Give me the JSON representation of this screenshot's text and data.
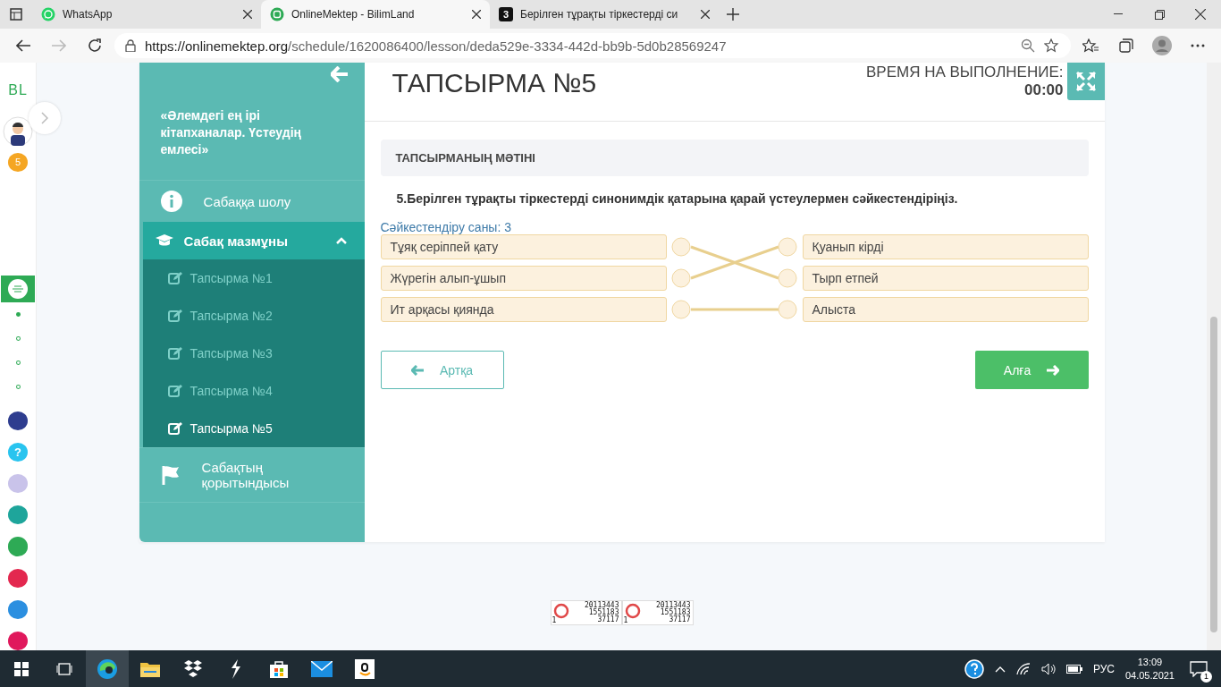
{
  "browser": {
    "tabs": [
      {
        "title": "WhatsApp",
        "selected": false
      },
      {
        "title": "OnlineMektep - BilimLand",
        "selected": true
      },
      {
        "title": "Берілген тұрақты тіркестерді си",
        "badge": "3",
        "selected": false
      }
    ],
    "url_host": "https://onlinemektep.org",
    "url_path": "/schedule/1620086400/lesson/deda529e-3334-442d-bb9b-5d0b28569247"
  },
  "rail": {
    "logo": "BL",
    "badge": "5",
    "steps": [
      {
        "selected": true
      },
      {
        "selected": false
      },
      {
        "selected": false
      },
      {
        "selected": false
      }
    ],
    "apps": [
      {
        "color": "#2e3d8f"
      },
      {
        "color": "#29c4ef",
        "label": "?"
      },
      {
        "color": "#c9c3ea"
      },
      {
        "color": "#1ea59b"
      },
      {
        "color": "#2eaa55"
      },
      {
        "color": "#e3284f"
      },
      {
        "color": "#2b8fe0"
      },
      {
        "color": "#e0185c"
      }
    ]
  },
  "sidebar": {
    "lesson_title": "«Әлемдегі ең ірі кітапханалар. Үстеудің емлесі»",
    "items": [
      {
        "kind": "info",
        "label": "Сабаққа шолу"
      },
      {
        "kind": "section",
        "label": "Сабақ мазмұны",
        "expanded": true,
        "children": [
          {
            "label": "Тапсырма №1",
            "selected": false
          },
          {
            "label": "Тапсырма №2",
            "selected": false
          },
          {
            "label": "Тапсырма №3",
            "selected": false
          },
          {
            "label": "Тапсырма №4",
            "selected": false
          },
          {
            "label": "Тапсырма №5",
            "selected": true
          }
        ]
      },
      {
        "kind": "flag",
        "label": "Сабақтың қорытындысы"
      }
    ]
  },
  "task": {
    "title": "ТАПСЫРМА №5",
    "timer_label": "ВРЕМЯ НА ВЫПОЛНЕНИЕ:",
    "timer": "00:00",
    "panel_heading": "ТАПСЫРМАНЫҢ МӘТІНІ",
    "question": "5.Берілген тұрақты тіркестерді синонимдік қатарына қарай үстеулермен сәйкестендіріңіз.",
    "match_count": "Сәйкестендіру саны: 3",
    "left": [
      "Тұяқ серіппей қату",
      "Жүрегін алып-ұшып",
      "Ит арқасы қиянда"
    ],
    "right": [
      "Қуанып кірді",
      "Тырп етпей",
      "Алыста"
    ],
    "links": [
      {
        "kind": "down"
      },
      {
        "kind": "up"
      },
      {
        "kind": "straight"
      }
    ],
    "back_button": "Артқа",
    "next_button": "Алға"
  },
  "counters": [
    {
      "lines": [
        "20113443",
        "1551183",
        "37117"
      ],
      "corner": "1"
    },
    {
      "lines": [
        "20113443",
        "1551183",
        "37117"
      ],
      "corner": "1"
    }
  ],
  "taskbar": {
    "language": "РУС",
    "time": "13:09",
    "date": "04.05.2021",
    "notifications": "1"
  }
}
